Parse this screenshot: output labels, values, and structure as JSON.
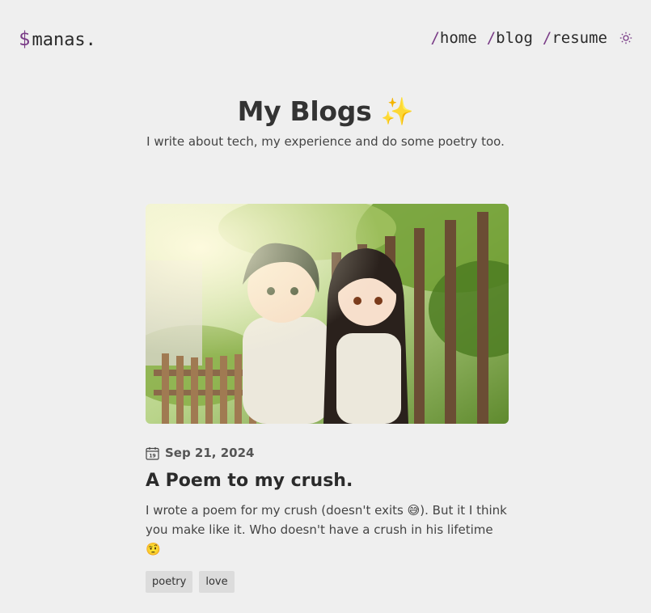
{
  "header": {
    "logo_symbol": "$",
    "logo_text": "manas.",
    "nav": [
      {
        "slash": "/",
        "label": "home"
      },
      {
        "slash": "/",
        "label": "blog"
      },
      {
        "slash": "/",
        "label": "resume"
      }
    ],
    "theme_icon": "sun-icon"
  },
  "hero": {
    "title": "My Blogs",
    "emoji": "✨",
    "subtitle": "I write about tech, my experience and do some poetry too."
  },
  "posts": [
    {
      "cover_icon": "anime-couple-illustration",
      "date": "Sep 21, 2024",
      "title": "A Poem to my crush.",
      "description": "I wrote a poem for my crush (doesn't exits 😅). But it I think you make like it. Who doesn't have a crush in his lifetime 🤨",
      "tags": [
        "poetry",
        "love"
      ]
    }
  ],
  "colors": {
    "background": "#efefef",
    "accent": "#7a3c87",
    "tag_bg": "#dcdcdc"
  }
}
